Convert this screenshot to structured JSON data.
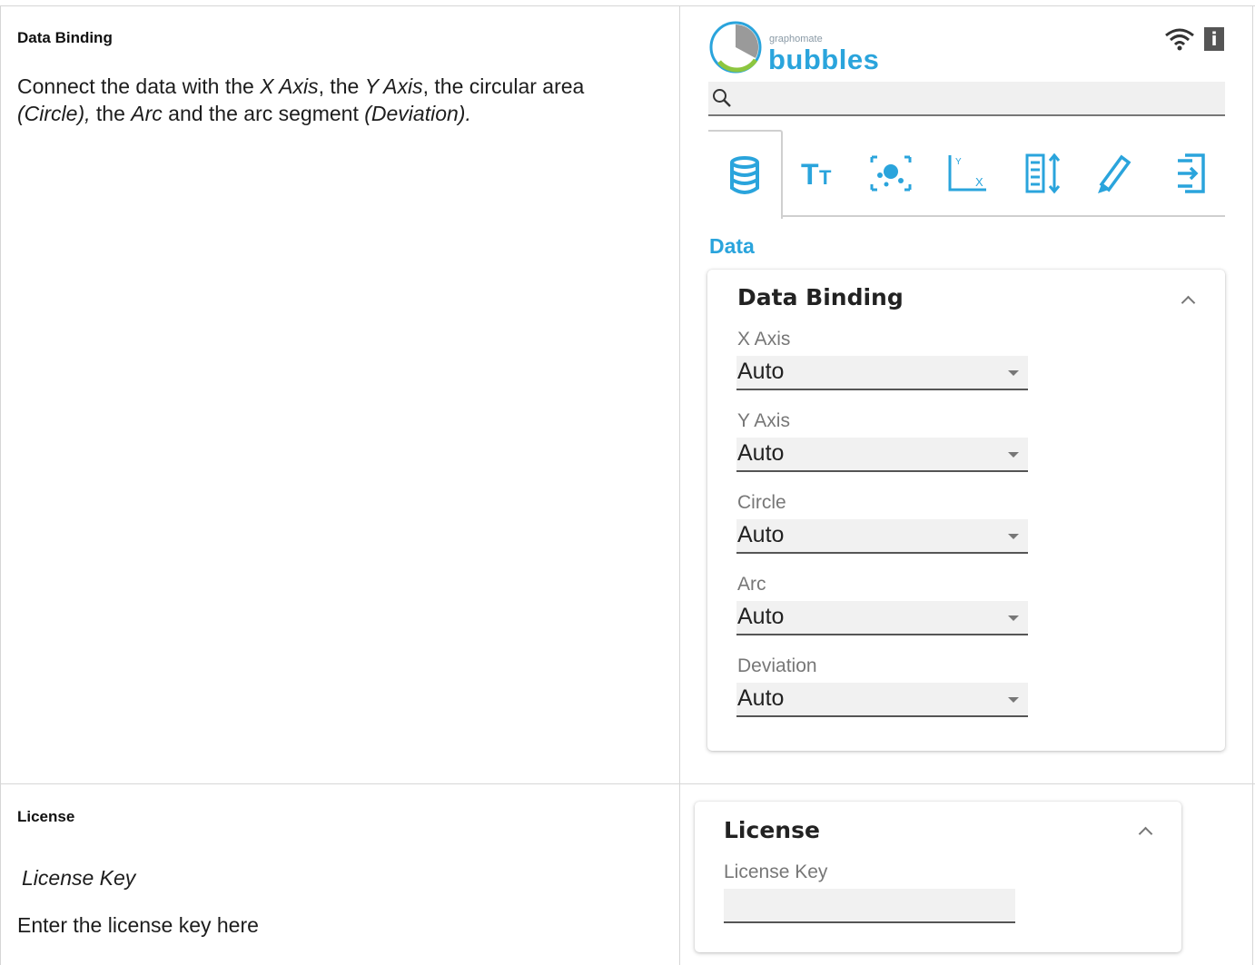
{
  "sections": [
    {
      "title": "Data Binding",
      "paragraph": {
        "t1": "Connect the data with the ",
        "i1": "X Axis",
        "t2": ", the ",
        "i2": " Y Axis",
        "t3": ", the circular area ",
        "i3": "(Circle),",
        "t4": " the ",
        "i4": "Arc",
        "t5": " and the arc segment ",
        "i5": "(Deviation)."
      }
    },
    {
      "title": "License",
      "sub_label": "License Key",
      "description": "Enter the license key here"
    }
  ],
  "panel": {
    "logo_small": "graphomate",
    "logo_big": "bubbles",
    "info_label": "i",
    "data_heading": "Data",
    "colors": {
      "accent": "#2aa4dc"
    },
    "tabs": [
      {
        "icon": "database-icon"
      },
      {
        "icon": "text-size-icon"
      },
      {
        "icon": "scatter-icon"
      },
      {
        "icon": "axis-icon"
      },
      {
        "icon": "layout-icon"
      },
      {
        "icon": "highlight-pen-icon"
      },
      {
        "icon": "export-icon"
      }
    ],
    "data_binding": {
      "title": "Data Binding",
      "fields": [
        {
          "label": "X Axis",
          "value": "Auto"
        },
        {
          "label": "Y Axis",
          "value": "Auto"
        },
        {
          "label": "Circle",
          "value": "Auto"
        },
        {
          "label": "Arc",
          "value": "Auto"
        },
        {
          "label": "Deviation",
          "value": "Auto"
        }
      ]
    },
    "license": {
      "title": "License",
      "label": "License Key",
      "value": ""
    }
  }
}
